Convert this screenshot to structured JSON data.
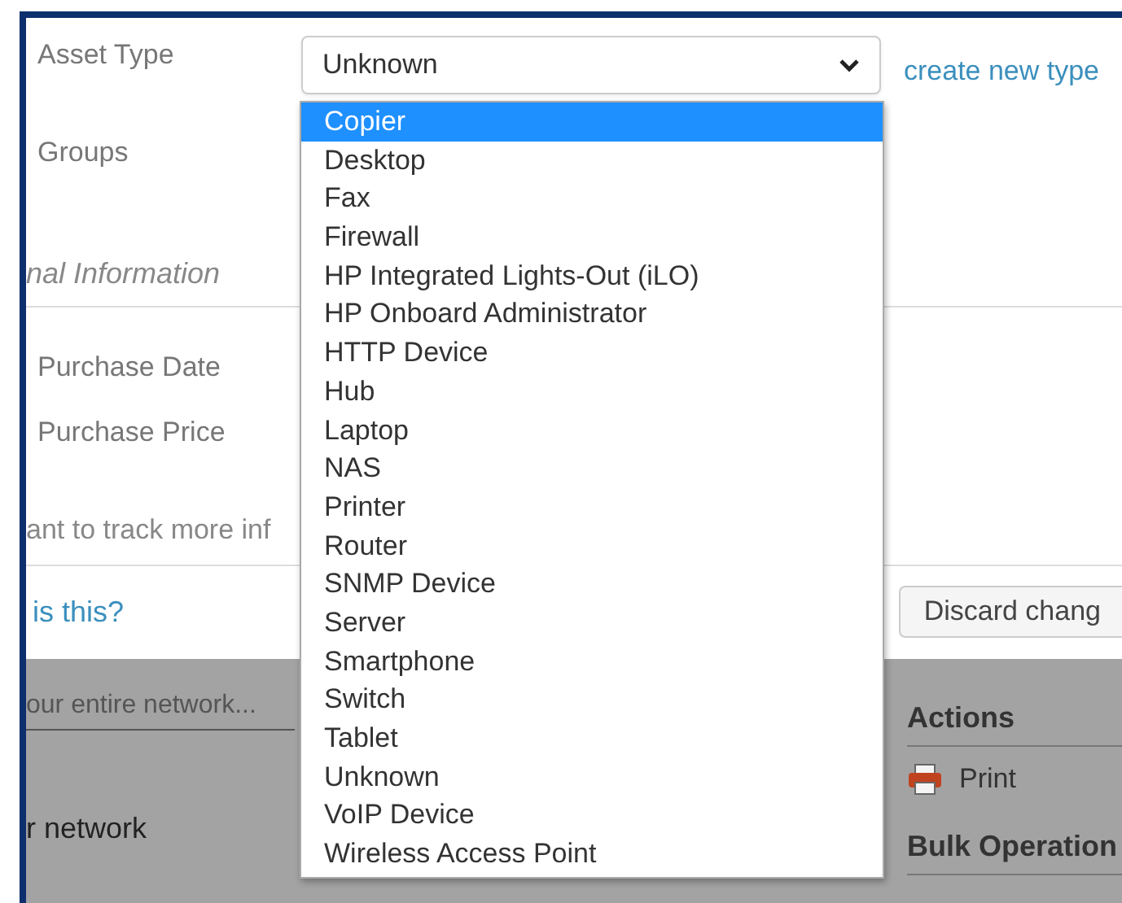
{
  "form": {
    "asset_type": {
      "label": "Asset Type",
      "value": "Unknown",
      "link": "create new type"
    },
    "groups": {
      "label": "Groups"
    },
    "section_heading": "nal Information",
    "purchase_date": {
      "label": "Purchase Date"
    },
    "purchase_price": {
      "label": "Purchase Price"
    },
    "track_more": "ant to track more inf",
    "help_link": "is this?",
    "discard_button": "Discard chang"
  },
  "dropdown": {
    "options": [
      {
        "label": "Copier",
        "selected": true
      },
      {
        "label": "Desktop",
        "selected": false
      },
      {
        "label": "Fax",
        "selected": false
      },
      {
        "label": "Firewall",
        "selected": false
      },
      {
        "label": "HP Integrated Lights-Out (iLO)",
        "selected": false
      },
      {
        "label": "HP Onboard Administrator",
        "selected": false
      },
      {
        "label": "HTTP Device",
        "selected": false
      },
      {
        "label": "Hub",
        "selected": false
      },
      {
        "label": "Laptop",
        "selected": false
      },
      {
        "label": "NAS",
        "selected": false
      },
      {
        "label": "Printer",
        "selected": false
      },
      {
        "label": "Router",
        "selected": false
      },
      {
        "label": "SNMP Device",
        "selected": false
      },
      {
        "label": "Server",
        "selected": false
      },
      {
        "label": "Smartphone",
        "selected": false
      },
      {
        "label": "Switch",
        "selected": false
      },
      {
        "label": "Tablet",
        "selected": false
      },
      {
        "label": "Unknown",
        "selected": false
      },
      {
        "label": "VoIP Device",
        "selected": false
      },
      {
        "label": "Wireless Access Point",
        "selected": false
      }
    ]
  },
  "background_page": {
    "search": {
      "placeholder": "our entire network..."
    },
    "nav_item": "r network",
    "actions_heading": "Actions",
    "print": "Print",
    "bulk_heading": "Bulk Operation"
  }
}
